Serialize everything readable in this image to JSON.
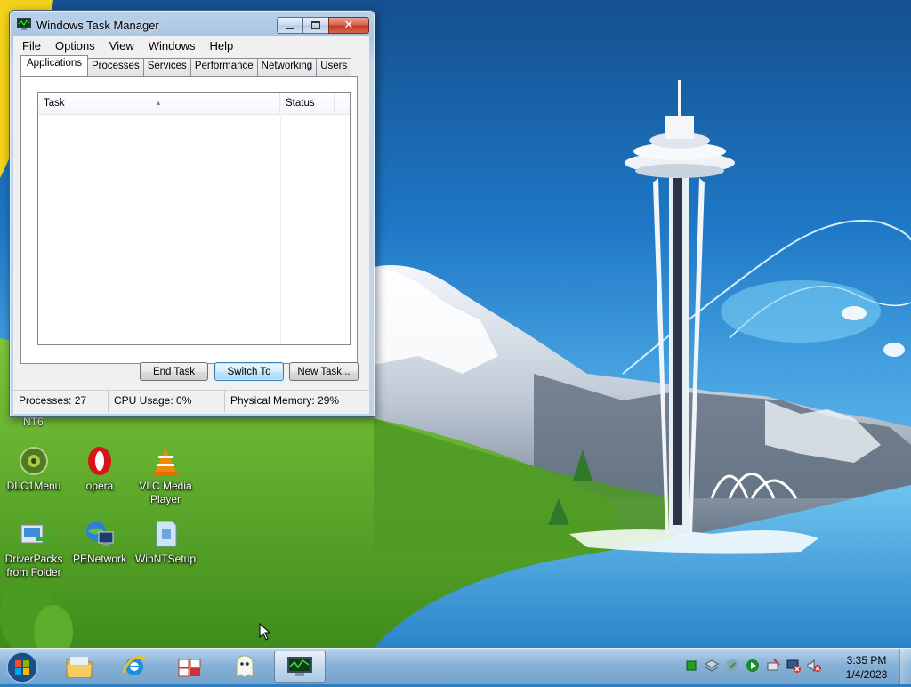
{
  "window": {
    "title": "Windows Task Manager",
    "menu": [
      "File",
      "Options",
      "View",
      "Windows",
      "Help"
    ],
    "tabs": [
      "Applications",
      "Processes",
      "Services",
      "Performance",
      "Networking",
      "Users"
    ],
    "active_tab": "Applications",
    "list_columns": [
      "Task",
      "Status"
    ],
    "buttons": {
      "end_task": "End Task",
      "switch_to": "Switch To",
      "new_task": "New Task..."
    },
    "status": {
      "processes": "Processes: 27",
      "cpu": "CPU Usage: 0%",
      "memory": "Physical Memory: 29%"
    }
  },
  "desktop": {
    "partial_labels": [
      "NT6"
    ],
    "icons": [
      {
        "label": "DLC1Menu",
        "icon": "dlc-menu-icon"
      },
      {
        "label": "opera",
        "icon": "opera-icon"
      },
      {
        "label": "VLC Media Player",
        "icon": "vlc-icon"
      },
      {
        "label": "DriverPacks from Folder",
        "icon": "driverpacks-icon"
      },
      {
        "label": "PENetwork",
        "icon": "penetwork-icon"
      },
      {
        "label": "WinNTSetup",
        "icon": "winntsetup-icon"
      }
    ]
  },
  "taskbar": {
    "pinned": [
      "start-orb-icon",
      "explorer-folder-icon",
      "internet-explorer-icon",
      "uninstall-tool-icon",
      "ghost-icon",
      "task-manager-icon"
    ],
    "tray_icons": [
      "green-square-icon",
      "layers-icon",
      "shield-check-icon",
      "play-icon",
      "network-tool-icon",
      "network-error-icon",
      "volume-muted-icon"
    ],
    "clock": {
      "time": "3:35 PM",
      "date": "1/4/2023"
    }
  },
  "colors": {
    "sky_top": "#1e6fc0",
    "grass": "#5ea72c",
    "water": "#3d9bd8",
    "window_frame": "#bcd3ec",
    "default_button_border": "#3c7fb1"
  }
}
